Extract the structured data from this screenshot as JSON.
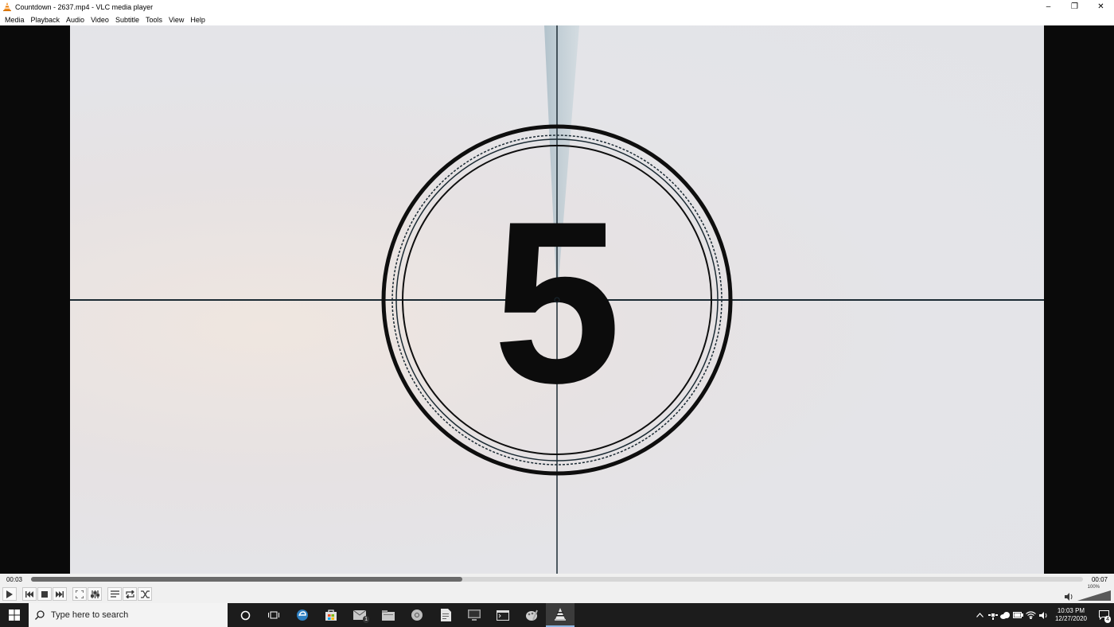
{
  "window": {
    "title": "Countdown - 2637.mp4 - VLC media player",
    "controls": {
      "minimize": "–",
      "maximize": "❐",
      "close": "✕"
    }
  },
  "menu": [
    "Media",
    "Playback",
    "Audio",
    "Video",
    "Subtitle",
    "Tools",
    "View",
    "Help"
  ],
  "video": {
    "countdown_digit": "5"
  },
  "player": {
    "elapsed": "00:03",
    "total": "00:07",
    "progress": 0.41,
    "volume": "100%",
    "buttons": [
      "play-icon",
      "previous-icon",
      "stop-icon",
      "next-icon",
      "fullscreen-icon",
      "extended-settings-icon",
      "playlist-icon",
      "loop-icon",
      "shuffle-icon"
    ]
  },
  "taskbar": {
    "search_placeholder": "Type here to search",
    "apps": [
      "cortana-icon",
      "task-view-icon",
      "edge-icon",
      "store-icon",
      "mail-icon",
      "file-explorer-icon",
      "chrome-icon",
      "document-icon",
      "monitor-icon",
      "terminal-icon",
      "paint-icon",
      "vlc-icon"
    ],
    "mail_badge": "1",
    "clock_time": "10:03 PM",
    "clock_date": "12/27/2020",
    "notification_count": "4"
  }
}
